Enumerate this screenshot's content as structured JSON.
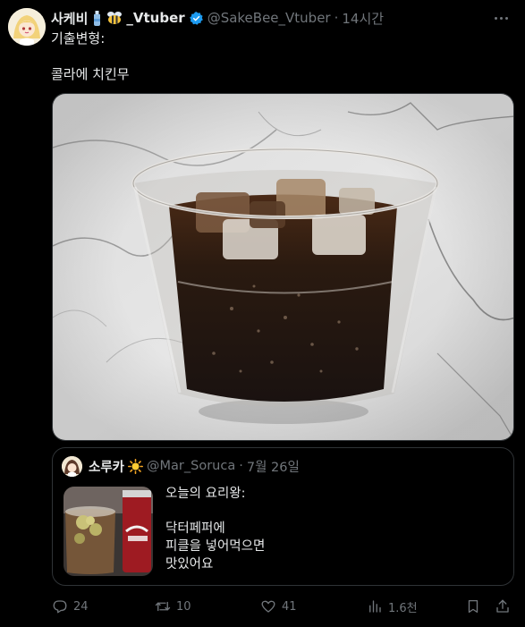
{
  "tweet": {
    "display_name": "사케비",
    "display_suffix": "_Vtuber",
    "name_emojis": [
      "bottle-icon",
      "bee-icon"
    ],
    "handle": "@SakeBee_Vtuber",
    "separator": "·",
    "time": "14시간",
    "text_lines": [
      "기출변형:",
      "콜라에 치킨무"
    ],
    "verified": true
  },
  "quote": {
    "display_name": "소루카",
    "name_emoji": "sun-icon",
    "handle": "@Mar_Soruca",
    "separator": "·",
    "date": "7월 26일",
    "text_lines": [
      "오늘의 요리왕:",
      "닥터페퍼에",
      "피클을 넣어먹으면",
      "맛있어요"
    ]
  },
  "actions": {
    "reply_count": "24",
    "retweet_count": "10",
    "like_count": "41",
    "views_count": "1.6천"
  },
  "colors": {
    "background": "#000000",
    "text": "#e7e9ea",
    "muted": "#71767b",
    "border": "#2f3336",
    "verified": "#1d9bf0"
  }
}
